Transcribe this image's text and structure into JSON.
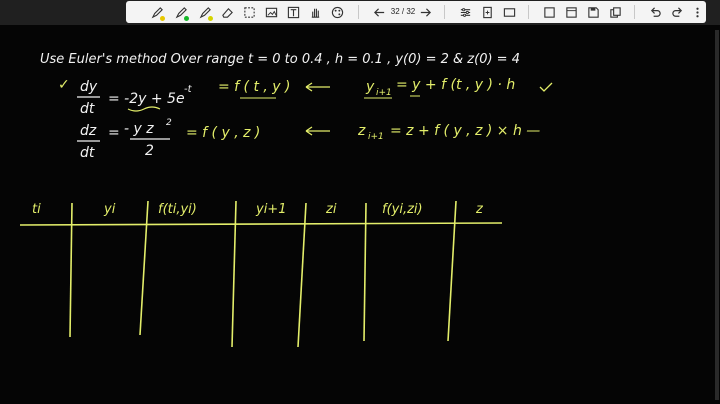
{
  "toolbar": {
    "tools": [
      {
        "icon": "pen-icon"
      },
      {
        "icon": "pen-icon"
      },
      {
        "icon": "pen-icon"
      },
      {
        "icon": "eraser-icon"
      },
      {
        "icon": "lasso-select-icon"
      },
      {
        "icon": "image-icon"
      },
      {
        "icon": "text-icon"
      },
      {
        "icon": "hand-pan-icon"
      },
      {
        "icon": "color-palette-icon"
      }
    ],
    "tool_dot_colors": [
      "#e8c800",
      "#17b92a",
      "#d4d400"
    ],
    "page_indicator": "32 / 32",
    "right_tools": [
      "prev-page-icon",
      "next-page-icon",
      "settings-icon",
      "insert-page-icon",
      "page-view-icon",
      "fit-page-icon",
      "save-icon",
      "copy-icon",
      "undo-icon",
      "redo-icon",
      "more-icon"
    ]
  },
  "notes": {
    "ink_color": "#e3ee6a",
    "text_color": "#f2f2f2",
    "header": "Use   Euler's method   Over range   t = 0 to 0.4 ,  h = 0.1 ,  y(0) = 2  &  z(0) = 4",
    "eq1_lhs_num": "dy",
    "eq1_lhs_den": "dt",
    "eq1_rhs": "= -2y + 5e",
    "eq1_exp": "-t",
    "eq1_f": "= f ( t , y )",
    "eq1_update": "y",
    "eq1_update_rest": "= y  + f (t , y ) · h",
    "eq2_lhs_num": "dz",
    "eq2_lhs_den": "dt",
    "eq2_rhs_num": "- y z",
    "eq2_rhs_den": "2",
    "eq2_f": "=   f ( y , z )",
    "eq2_update": "z",
    "eq2_update_rest": "= z  + f ( y , z ) × h   —",
    "table_headers": [
      "ti",
      "yi",
      "f(ti,yi)",
      "yi+1",
      "zi",
      "f(yi,zi)",
      "z"
    ]
  }
}
